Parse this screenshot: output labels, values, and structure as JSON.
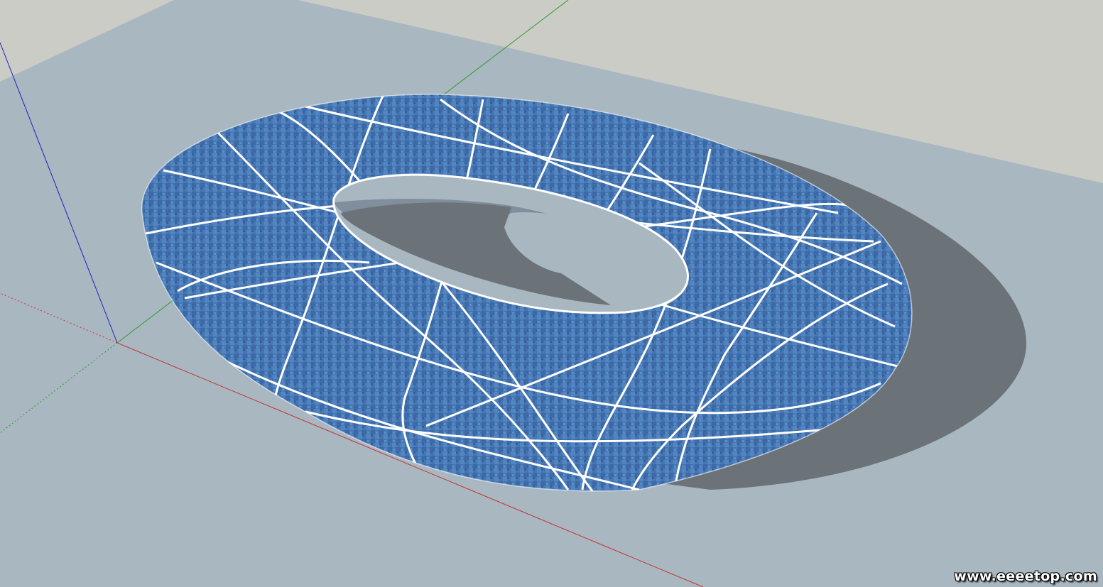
{
  "app": {
    "type": "3d-modeling-viewport",
    "background_color": "#a9b7c1",
    "sky_color": "#ccccc6"
  },
  "scene": {
    "model": "torus-ring",
    "surface_texture": "blue-mosaic-tile",
    "surface_color": "#4a7bb8",
    "structure_line_color": "#ffffff",
    "shadow_color": "#6b7278",
    "axes": {
      "red_axis_color": "#c83232",
      "green_axis_color": "#2e9a2e",
      "blue_axis_color": "#2020c0"
    }
  },
  "watermark": {
    "text": "www.eeeetop.com"
  }
}
